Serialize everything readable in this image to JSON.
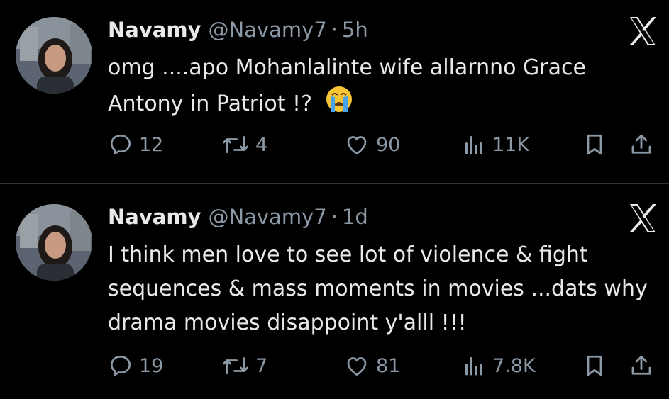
{
  "tweets": [
    {
      "author_name": "Navamy",
      "handle": "@Navamy7",
      "separator": "·",
      "time": "5h",
      "text": "omg ....apo Mohanlalinte wife allarnno Grace Antony in Patriot !?",
      "emoji": "crying-face-emoji",
      "stats": {
        "replies": "12",
        "reposts": "4",
        "likes": "90",
        "views": "11K"
      }
    },
    {
      "author_name": "Navamy",
      "handle": "@Navamy7",
      "separator": "·",
      "time": "1d",
      "text": "I think men love to see lot of violence & fight sequences & mass moments in  movies ...dats why drama movies disappoint y'alll !!!",
      "stats": {
        "replies": "19",
        "reposts": "7",
        "likes": "81",
        "views": "7.8K"
      }
    }
  ],
  "icons": [
    "x-logo-icon",
    "reply-icon",
    "repost-icon",
    "like-icon",
    "views-icon",
    "bookmark-icon",
    "share-icon"
  ],
  "colors": {
    "background": "#000000",
    "text": "#e7e9ea",
    "muted": "#8b98a5",
    "divider": "#2f3336"
  }
}
